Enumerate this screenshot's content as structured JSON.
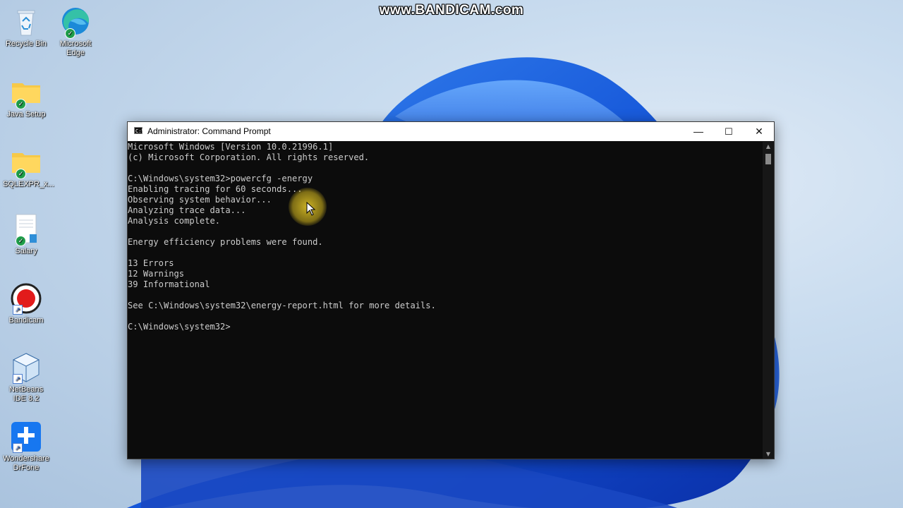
{
  "watermark": "www.BANDICAM.com",
  "desktop": {
    "icons": [
      {
        "label": "Recycle Bin"
      },
      {
        "label": "Microsoft Edge"
      },
      {
        "label": "Java Setup"
      },
      {
        "label": "SQLEXPR_x..."
      },
      {
        "label": "Salary"
      },
      {
        "label": "Bandicam"
      },
      {
        "label": "NetBeans IDE 8.2"
      },
      {
        "label": "Wondershare DrFone"
      }
    ]
  },
  "window": {
    "title": "Administrator: Command Prompt",
    "icon": "console-icon",
    "controls": {
      "minimize": "—",
      "maximize": "☐",
      "close": "✕"
    }
  },
  "console": {
    "lines": [
      "Microsoft Windows [Version 10.0.21996.1]",
      "(c) Microsoft Corporation. All rights reserved.",
      "",
      "C:\\Windows\\system32>powercfg -energy",
      "Enabling tracing for 60 seconds...",
      "Observing system behavior...",
      "Analyzing trace data...",
      "Analysis complete.",
      "",
      "Energy efficiency problems were found.",
      "",
      "13 Errors",
      "12 Warnings",
      "39 Informational",
      "",
      "See C:\\Windows\\system32\\energy-report.html for more details.",
      "",
      "C:\\Windows\\system32>"
    ]
  },
  "colors": {
    "console_bg": "#0c0c0c",
    "console_fg": "#cccccc",
    "cursor_highlight": "#e8c820"
  }
}
